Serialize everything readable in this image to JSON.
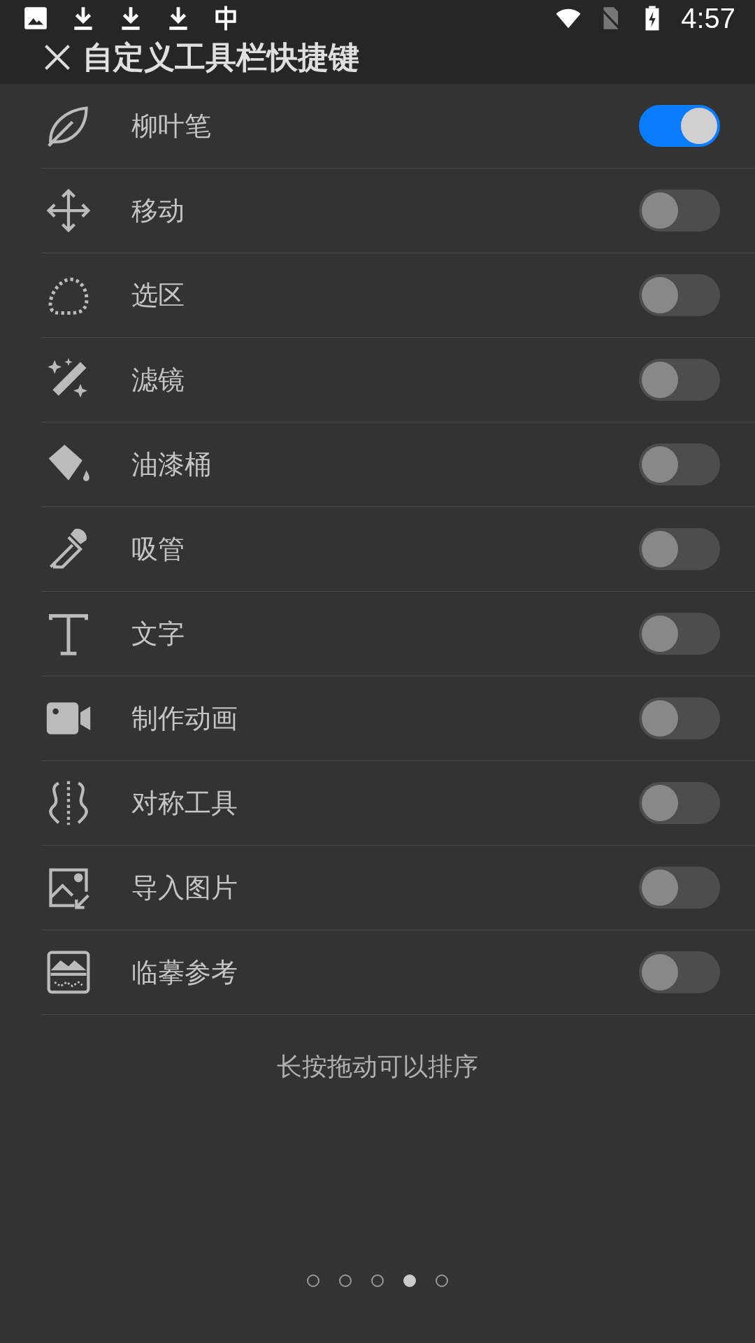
{
  "status_bar": {
    "time": "4:57"
  },
  "header": {
    "title": "自定义工具栏快捷键"
  },
  "tools": [
    {
      "kind": "leaf",
      "label": "柳叶笔",
      "on": true
    },
    {
      "kind": "move",
      "label": "移动",
      "on": false
    },
    {
      "kind": "lasso",
      "label": "选区",
      "on": false
    },
    {
      "kind": "wand",
      "label": "滤镜",
      "on": false
    },
    {
      "kind": "bucket",
      "label": "油漆桶",
      "on": false
    },
    {
      "kind": "dropper",
      "label": "吸管",
      "on": false
    },
    {
      "kind": "text",
      "label": "文字",
      "on": false
    },
    {
      "kind": "video",
      "label": "制作动画",
      "on": false
    },
    {
      "kind": "symmetry",
      "label": "对称工具",
      "on": false
    },
    {
      "kind": "import",
      "label": "导入图片",
      "on": false
    },
    {
      "kind": "reference",
      "label": "临摹参考",
      "on": false
    }
  ],
  "hint": "长按拖动可以排序",
  "pager": [
    {
      "selected": false
    },
    {
      "selected": false
    },
    {
      "selected": false
    },
    {
      "selected": true
    },
    {
      "selected": false
    }
  ]
}
